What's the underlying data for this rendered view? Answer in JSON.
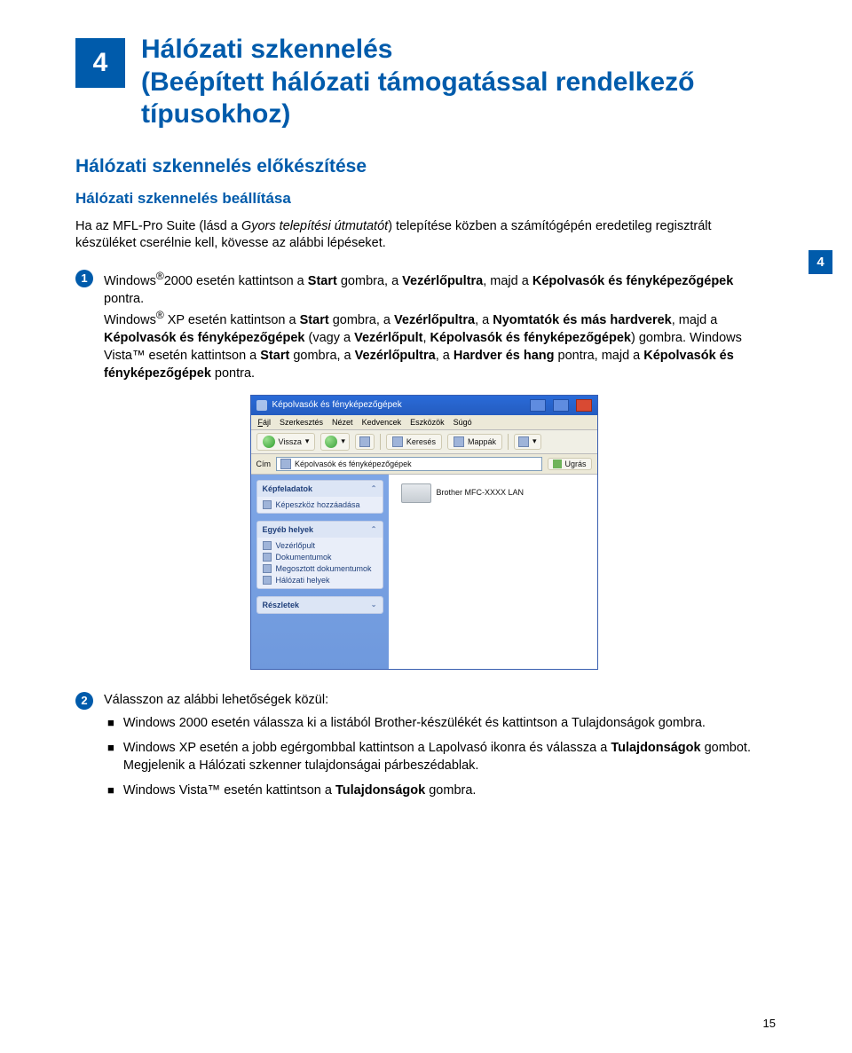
{
  "chapter": {
    "number": "4",
    "title_line1": "Hálózati szkennelés",
    "title_line2": "(Beépített hálózati támogatással rendelkező típusokhoz)"
  },
  "side_tab": "4",
  "h2": "Hálózati szkennelés előkészítése",
  "h3": "Hálózati szkennelés beállítása",
  "intro": {
    "pre": "Ha az MFL-Pro Suite (lásd a ",
    "italic": "Gyors telepítési útmutatót",
    "post": ") telepítése közben a számítógépén eredetileg regisztrált készüléket cserélnie kell, kövesse az alábbi lépéseket."
  },
  "step1": {
    "p1_a": "Windows",
    "p1_reg": "®",
    "p1_b": "2000 esetén kattintson a ",
    "p1_start": "Start",
    "p1_c": " gombra, a ",
    "p1_vp": "Vezérlőpultra",
    "p1_d": ", majd a ",
    "p1_ke": "Képolvasók és fényképezőgépek",
    "p1_e": " pontra.",
    "p2_a": "Windows",
    "p2_reg": "®",
    "p2_xp": " XP esetén kattintson a ",
    "p2_start": "Start",
    "p2_b": " gombra, a ",
    "p2_vp": "Vezérlőpultra",
    "p2_c": ", a ",
    "p2_ny": "Nyomtatók és más hardverek",
    "p2_d": ", majd a ",
    "p2_ke": "Képolvasók és fényképezőgépek",
    "p2_e": " (vagy a ",
    "p2_vp2": "Vezérlőpult",
    "p2_f": ", ",
    "p2_ke2": "Képolvasók és fényképezőgépek",
    "p2_g": ") gombra. Windows Vista™ esetén kattintson a ",
    "p2_start2": "Start",
    "p2_h": " gombra, a ",
    "p2_vp3": "Vezérlőpultra",
    "p2_i": ", a ",
    "p2_hh": "Hardver és hang",
    "p2_j": " pontra, majd a ",
    "p2_ke3": "Képolvasók és fényképezőgépek",
    "p2_k": " pontra."
  },
  "screenshot": {
    "title": "Képolvasók és fényképezőgépek",
    "menu": {
      "m1": "Fájl",
      "m2": "Szerkesztés",
      "m3": "Nézet",
      "m4": "Kedvencek",
      "m5": "Eszközök",
      "m6": "Súgó"
    },
    "toolbar": {
      "back": "Vissza",
      "search": "Keresés",
      "folders": "Mappák"
    },
    "addr_label": "Cím",
    "addr_value": "Képolvasók és fényképezőgépek",
    "go": "Ugrás",
    "panel1_head": "Képfeladatok",
    "panel1_item": "Képeszköz hozzáadása",
    "panel2_head": "Egyéb helyek",
    "panel2_items": [
      "Vezérlőpult",
      "Dokumentumok",
      "Megosztott dokumentumok",
      "Hálózati helyek"
    ],
    "panel3_head": "Részletek",
    "device": "Brother MFC-XXXX  LAN"
  },
  "step2": {
    "lead": "Válasszon az alábbi lehetőségek közül:",
    "b1_a": "Windows 2000 esetén válassza ki a listából Brother-készülékét és kattintson a Tulajdonságok gombra.",
    "b2_a": "Windows XP esetén a jobb egérgombbal kattintson a Lapolvasó ikonra és válassza a ",
    "b2_bold": "Tulajdonságok",
    "b2_b": " gombot.",
    "b2_c": "Megjelenik a Hálózati szkenner tulajdonságai párbeszédablak.",
    "b3_a": "Windows Vista™ esetén kattintson a ",
    "b3_bold": "Tulajdonságok",
    "b3_b": " gombra."
  },
  "page_number": "15"
}
